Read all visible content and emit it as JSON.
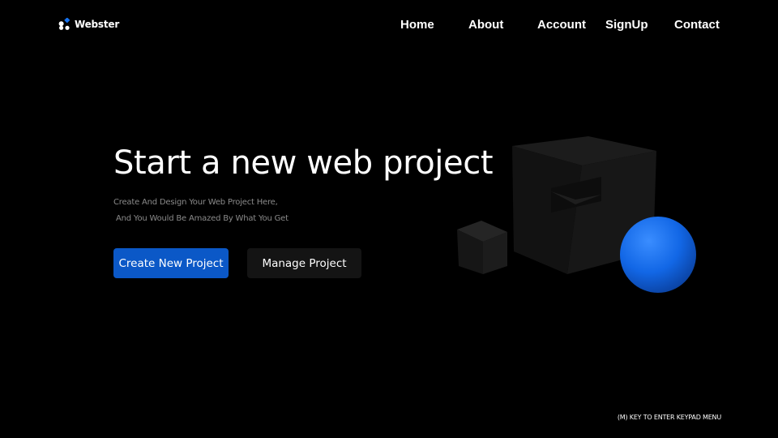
{
  "brand": {
    "name": "Webster",
    "logo_icon": "dots-logo-icon"
  },
  "nav": {
    "items": [
      {
        "label": "Home"
      },
      {
        "label": "About"
      },
      {
        "label": "Account"
      },
      {
        "label": "SignUp"
      },
      {
        "label": "Contact"
      }
    ]
  },
  "hero": {
    "title": "Start a new web project",
    "subtitle_line1": "Create And Design Your Web Project Here,",
    "subtitle_line2": " And You Would Be Amazed By What You Get",
    "primary_button": "Create New Project",
    "secondary_button": "Manage Project"
  },
  "footer": {
    "keypad_hint": "(M) KEY TO ENTER KEYPAD MENU"
  },
  "colors": {
    "background": "#000000",
    "accent": "#0b58c7",
    "sphere": "#1673f0",
    "secondary_button": "#141414",
    "subtitle_text": "#8a8a8a"
  }
}
